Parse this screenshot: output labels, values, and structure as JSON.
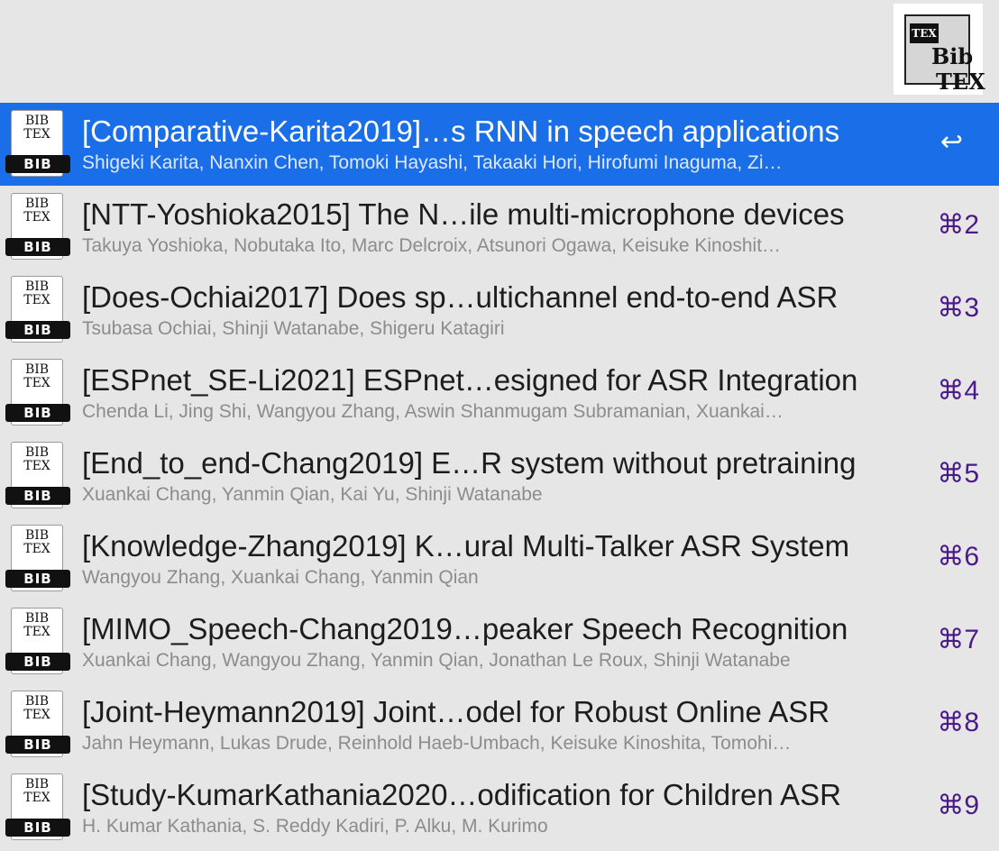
{
  "header": {
    "logo_icon": "bibtex-logo-icon",
    "logo_tex_badge": "TEX",
    "logo_bib": "Bib",
    "logo_tex": "TEX"
  },
  "colors": {
    "selected_bg": "#1a6ee8",
    "background": "#e6e6e6",
    "shortcut": "#4b1a8a"
  },
  "icon": {
    "name": "bibtex-file-icon",
    "top": "BIB",
    "bottom": "TEX",
    "strip": "BIB"
  },
  "results": [
    {
      "title": "[Comparative-Karita2019]…s RNN in speech applications",
      "authors": "Shigeki Karita, Nanxin Chen, Tomoki Hayashi, Takaaki Hori, Hirofumi Inaguma, Zi…",
      "shortcut": "↩",
      "selected": true
    },
    {
      "title": "[NTT-Yoshioka2015] The N…ile multi-microphone devices",
      "authors": "Takuya Yoshioka, Nobutaka Ito, Marc Delcroix, Atsunori Ogawa, Keisuke Kinoshit…",
      "shortcut": "⌘2",
      "selected": false
    },
    {
      "title": "[Does-Ochiai2017] Does sp…ultichannel end-to-end ASR",
      "authors": "Tsubasa Ochiai, Shinji Watanabe, Shigeru Katagiri",
      "shortcut": "⌘3",
      "selected": false
    },
    {
      "title": "[ESPnet_SE-Li2021] ESPnet…esigned for ASR Integration",
      "authors": "Chenda Li, Jing Shi, Wangyou Zhang, Aswin Shanmugam Subramanian, Xuankai…",
      "shortcut": "⌘4",
      "selected": false
    },
    {
      "title": "[End_to_end-Chang2019] E…R system without pretraining",
      "authors": "Xuankai Chang, Yanmin Qian, Kai Yu, Shinji Watanabe",
      "shortcut": "⌘5",
      "selected": false
    },
    {
      "title": "[Knowledge-Zhang2019] K…ural Multi-Talker ASR System",
      "authors": "Wangyou Zhang, Xuankai Chang, Yanmin Qian",
      "shortcut": "⌘6",
      "selected": false
    },
    {
      "title": "[MIMO_Speech-Chang2019…peaker Speech Recognition",
      "authors": "Xuankai Chang, Wangyou Zhang, Yanmin Qian, Jonathan Le Roux, Shinji Watanabe",
      "shortcut": "⌘7",
      "selected": false
    },
    {
      "title": "[Joint-Heymann2019] Joint…odel for Robust Online ASR",
      "authors": "Jahn Heymann, Lukas Drude, Reinhold Haeb-Umbach, Keisuke Kinoshita, Tomohi…",
      "shortcut": "⌘8",
      "selected": false
    },
    {
      "title": "[Study-KumarKathania2020…odification for Children ASR",
      "authors": "H. Kumar Kathania, S. Reddy Kadiri, P. Alku, M. Kurimo",
      "shortcut": "⌘9",
      "selected": false
    }
  ]
}
